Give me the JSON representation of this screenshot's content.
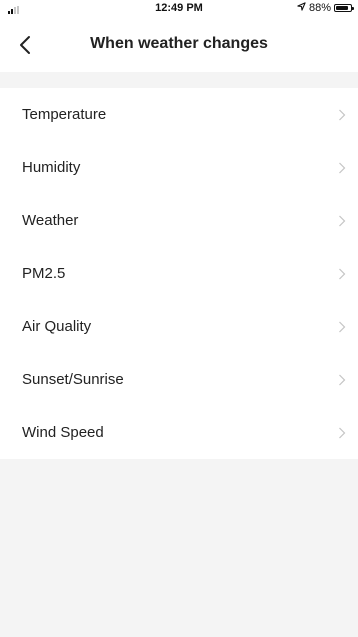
{
  "status_bar": {
    "time": "12:49 PM",
    "battery": "88%",
    "battery_level": 0.88,
    "icons": [
      "signal-icon",
      "location-icon",
      "battery-icon"
    ]
  },
  "header": {
    "title": "When weather changes",
    "back_icon": "chevron-left-icon"
  },
  "conditions": {
    "items": [
      {
        "label": "Temperature",
        "icon": "chevron-right-icon"
      },
      {
        "label": "Humidity",
        "icon": "chevron-right-icon"
      },
      {
        "label": "Weather",
        "icon": "chevron-right-icon"
      },
      {
        "label": "PM2.5",
        "icon": "chevron-right-icon"
      },
      {
        "label": "Air Quality",
        "icon": "chevron-right-icon"
      },
      {
        "label": "Sunset/Sunrise",
        "icon": "chevron-right-icon"
      },
      {
        "label": "Wind Speed",
        "icon": "chevron-right-icon"
      }
    ]
  },
  "colors": {
    "background": "#f4f4f4",
    "surface": "#ffffff",
    "text": "#222222",
    "chevron": "#c4c4c4"
  }
}
